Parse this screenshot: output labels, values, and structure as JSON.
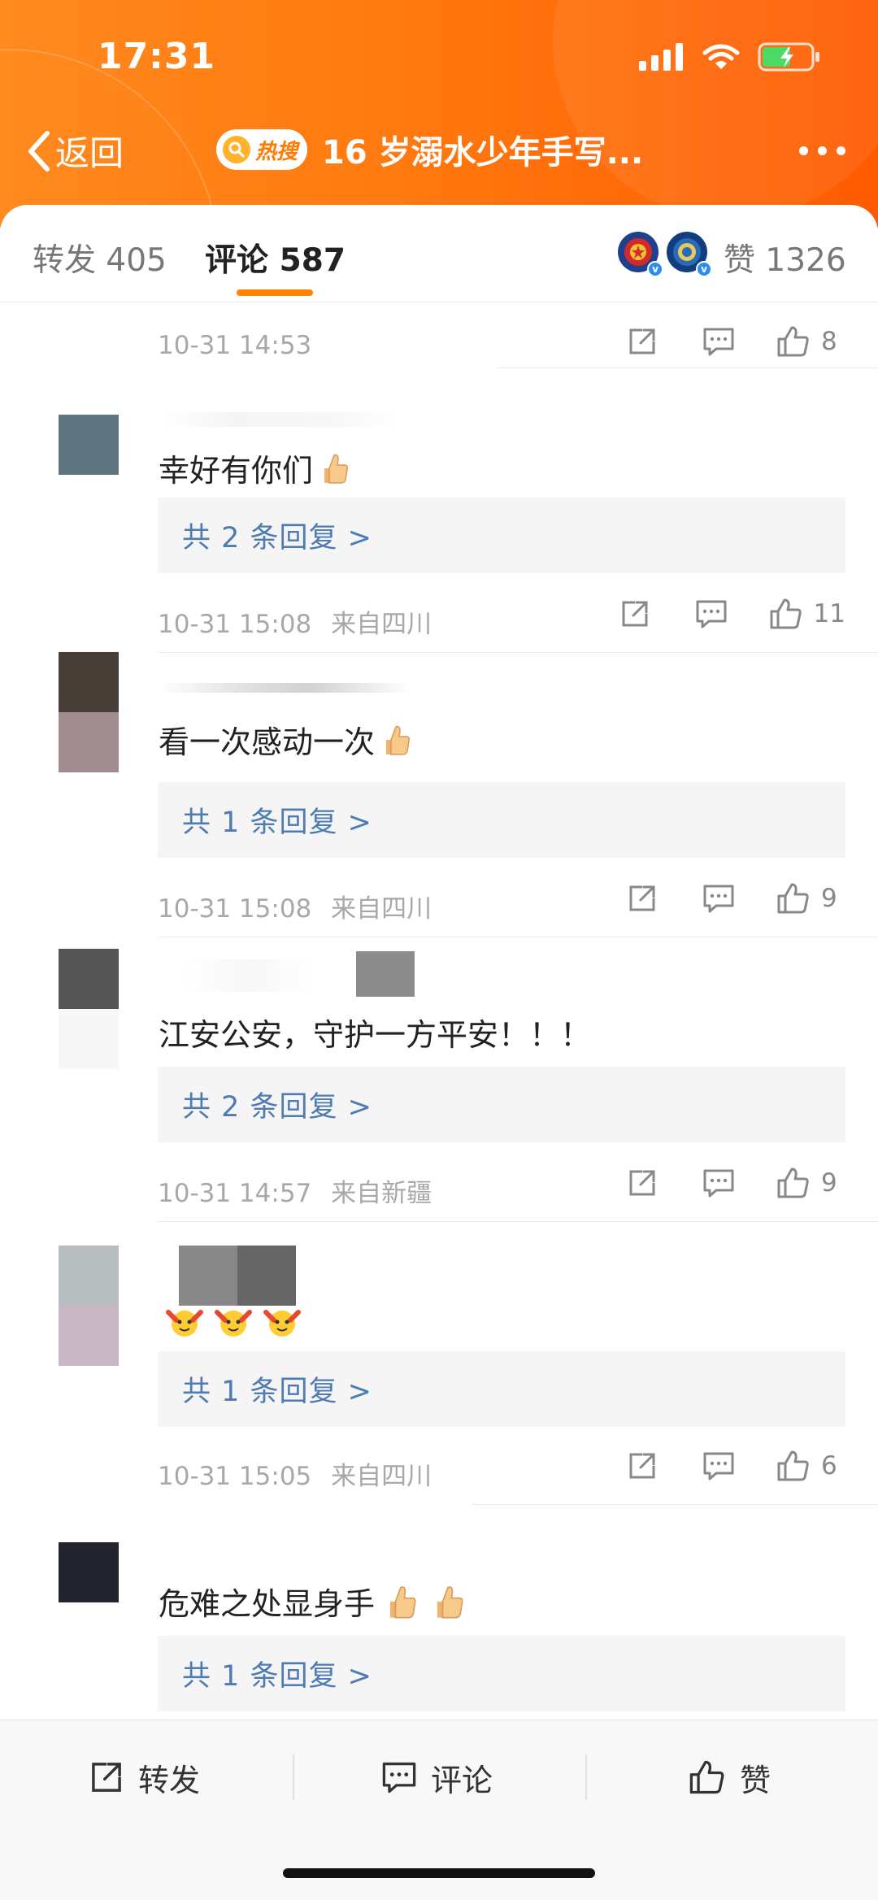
{
  "status_bar": {
    "time": "17:31"
  },
  "nav": {
    "back_label": "返回",
    "hot_badge": "热搜",
    "title": "16 岁溺水少年手写..."
  },
  "tabs": {
    "repost": "转发 405",
    "comments": "评论 587",
    "likes": "赞 1326"
  },
  "comments": [
    {
      "time": "10-31 14:53",
      "location": "",
      "likes": "8"
    },
    {
      "text": "幸好有你们",
      "reply": "共 2 条回复 >",
      "time": "10-31 15:08",
      "location": "来自四川",
      "likes": "11"
    },
    {
      "text": "看一次感动一次",
      "reply": "共 1 条回复 >",
      "time": "10-31 15:08",
      "location": "来自四川",
      "likes": "9"
    },
    {
      "text": "江安公安，守护一方平安！！！",
      "reply": "共 2 条回复 >",
      "time": "10-31 14:57",
      "location": "来自新疆",
      "likes": "9"
    },
    {
      "text": "",
      "reply": "共 1 条回复 >",
      "time": "10-31 15:05",
      "location": "来自四川",
      "likes": "6"
    },
    {
      "text": "危难之处显身手",
      "reply": "共 1 条回复 >"
    }
  ],
  "bottom_bar": {
    "repost": "转发",
    "comment": "评论",
    "like": "赞"
  },
  "colors": {
    "header_start": "#ff8a1e",
    "header_end": "#ff5a00",
    "accent": "#ff8200",
    "link": "#4d7bb2"
  }
}
